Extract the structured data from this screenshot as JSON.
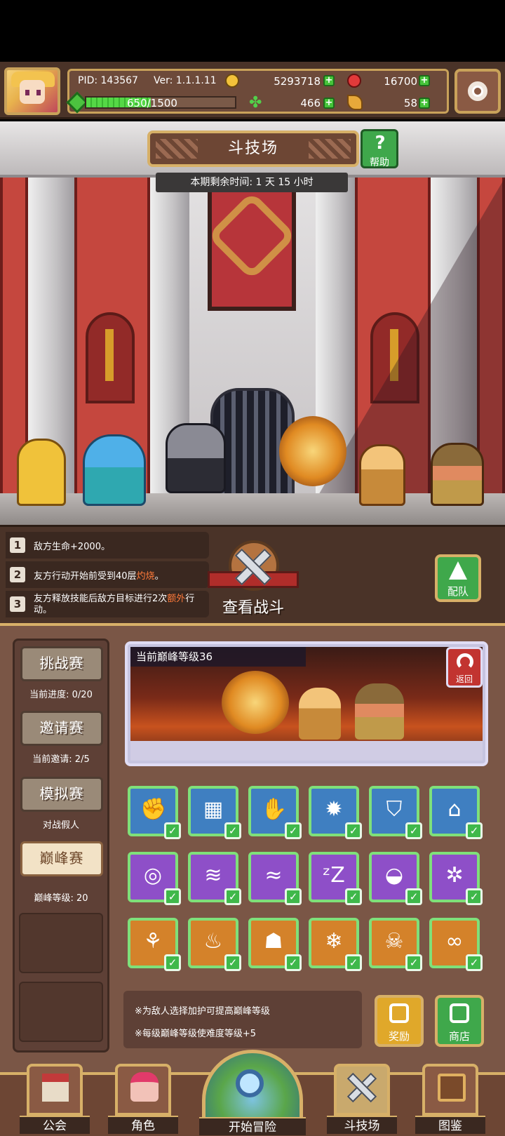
{
  "header": {
    "pid": "PID: 143567",
    "version": "Ver: 1.1.1.11",
    "gold": "5293718",
    "gems": "16700",
    "exp": "650/1500",
    "exp_fraction": 0.433,
    "clover": "466",
    "horn": "58"
  },
  "arena": {
    "title": "斗技场",
    "help_label": "帮助",
    "timer": "本期剩余时间: 1 天 15 小时"
  },
  "rules": [
    {
      "num": "1",
      "text": "敌方生命+2000。"
    },
    {
      "num": "2",
      "text_pre": "友方行动开始前受到40层",
      "text_hl": "灼烧",
      "text_post": "。"
    },
    {
      "num": "3",
      "text_pre": "友方释放技能后敌方目标进行2次",
      "text_hl": "额外",
      "text_post": "行动。"
    }
  ],
  "actions": {
    "watch_battle": "查看战斗",
    "team": "配队",
    "back": "返回",
    "reward": "奖励",
    "shop": "商店"
  },
  "modes": [
    {
      "label": "挑战赛",
      "sub": "当前进度: 0/20"
    },
    {
      "label": "邀请赛",
      "sub": "当前邀请: 2/5"
    },
    {
      "label": "模拟赛",
      "sub": "对战假人"
    },
    {
      "label": "巅峰赛",
      "sub": "巅峰等级: 20"
    }
  ],
  "preview": {
    "level_text": "当前巅峰等级36"
  },
  "buffs": [
    {
      "icon": "fist-icon",
      "glyph": "✊",
      "color": "blue"
    },
    {
      "icon": "wall-icon",
      "glyph": "▦",
      "color": "blue"
    },
    {
      "icon": "claw-icon",
      "glyph": "✋",
      "color": "blue"
    },
    {
      "icon": "sun-icon",
      "glyph": "✹",
      "color": "blue"
    },
    {
      "icon": "shield-icon",
      "glyph": "⛉",
      "color": "blue"
    },
    {
      "icon": "tomb-icon",
      "glyph": "⌂",
      "color": "blue"
    },
    {
      "icon": "rings-icon",
      "glyph": "◎",
      "color": "purple"
    },
    {
      "icon": "tornado-icon",
      "glyph": "≋",
      "color": "purple"
    },
    {
      "icon": "wave-icon",
      "glyph": "≈",
      "color": "purple"
    },
    {
      "icon": "sleep-icon",
      "glyph": "ᶻZ",
      "color": "purple"
    },
    {
      "icon": "slime-icon",
      "glyph": "◒",
      "color": "purple"
    },
    {
      "icon": "spark-icon",
      "glyph": "✲",
      "color": "purple"
    },
    {
      "icon": "bee-icon",
      "glyph": "⚘",
      "color": "orange"
    },
    {
      "icon": "fire-icon",
      "glyph": "♨",
      "color": "orange"
    },
    {
      "icon": "ghost-icon",
      "glyph": "☗",
      "color": "orange"
    },
    {
      "icon": "snowflake-icon",
      "glyph": "❄",
      "color": "orange"
    },
    {
      "icon": "skull-icon",
      "glyph": "☠",
      "color": "orange"
    },
    {
      "icon": "infinity-icon",
      "glyph": "∞",
      "color": "orange"
    }
  ],
  "notes": [
    "※为敌人选择加护可提高巅峰等级",
    "※每级巅峰等级使难度等级+5"
  ],
  "nav": {
    "guild": "公会",
    "character": "角色",
    "adventure": "开始冒险",
    "arena": "斗技场",
    "codex": "图鉴"
  },
  "colors": {
    "accent_gold": "#d7b068",
    "panel_brown": "#7a5646",
    "buff_blue": "#3f7fc1",
    "buff_purple": "#8e4fc8",
    "buff_orange": "#d4822a",
    "check_green": "#3fb84a",
    "highlight_orange": "#ff7a3a"
  }
}
